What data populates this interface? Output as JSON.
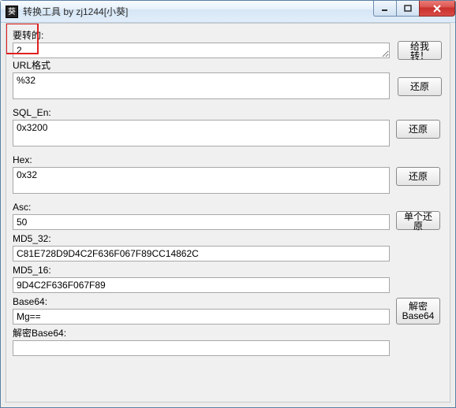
{
  "window": {
    "title": "转换工具 by zj1244[小葵]"
  },
  "labels": {
    "input": "要转的:",
    "url": "URL格式",
    "sql_en": "SQL_En:",
    "hex": "Hex:",
    "asc": "Asc:",
    "md5_32": "MD5_32:",
    "md5_16": "MD5_16:",
    "base64": "Base64:",
    "decode_base64": "解密Base64:"
  },
  "values": {
    "input": "2",
    "url": "%32",
    "sql_en": "0x3200",
    "hex": "0x32",
    "asc": "50",
    "md5_32": "C81E728D9D4C2F636F067F89CC14862C",
    "md5_16": "9D4C2F636F067F89",
    "base64": "Mg==",
    "decode_base64": ""
  },
  "buttons": {
    "convert": "给我转！",
    "restore": "还原",
    "single_restore": "单个还原",
    "decrypt_base64": "解密\nBase64"
  }
}
